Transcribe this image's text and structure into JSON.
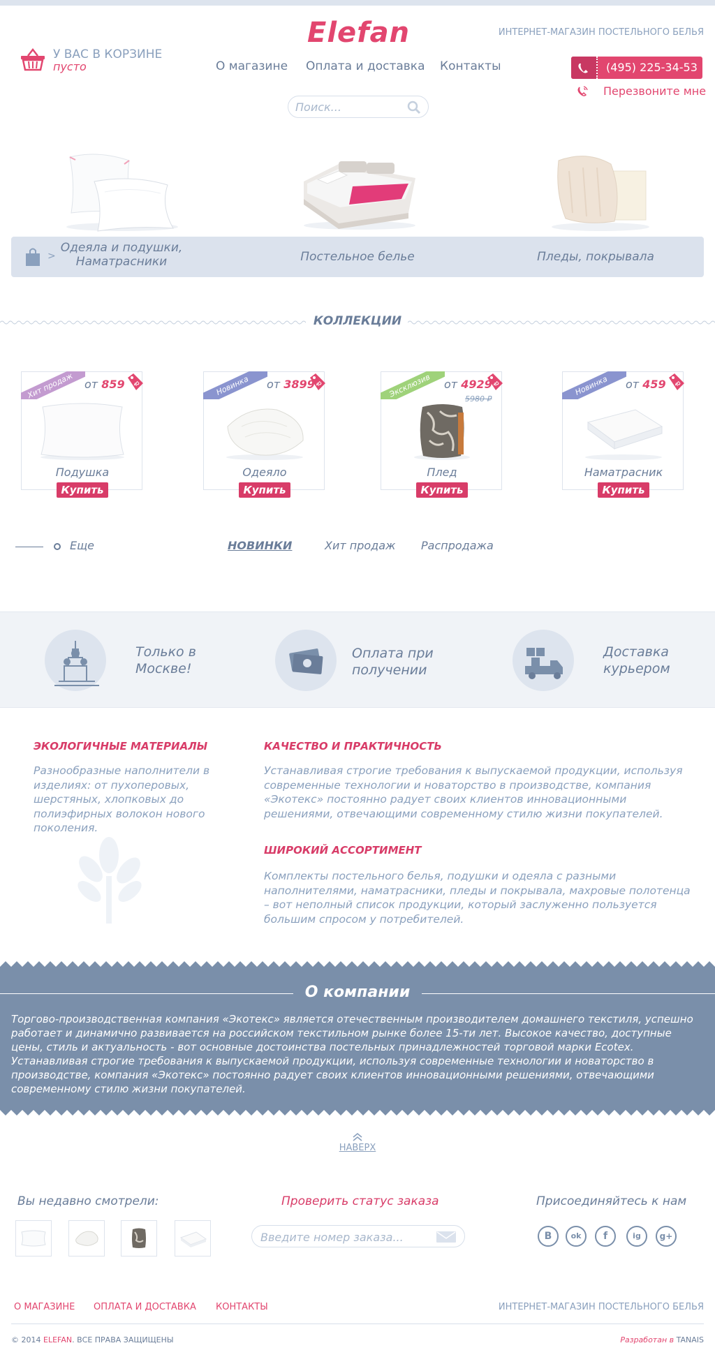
{
  "header": {
    "logo": "Elefan",
    "tagline": "ИНТЕРНЕТ-МАГАЗИН ПОСТЕЛЬНОГО БЕЛЬЯ",
    "cart_label": "У ВАС В КОРЗИНЕ",
    "cart_status": "пусто",
    "nav": [
      "О магазине",
      "Оплата и доставка",
      "Контакты"
    ],
    "phone": "(495) 225-34-53",
    "callback": "Перезвоните мне",
    "search_placeholder": "Поиск..."
  },
  "categories": [
    {
      "label_line1": "Одеяла и подушки,",
      "label_line2": "Наматрасники"
    },
    {
      "label": "Постельное белье"
    },
    {
      "label": "Пледы, покрывала"
    }
  ],
  "collections": {
    "title": "КОЛЛЕКЦИИ",
    "products": [
      {
        "badge": "Хит продаж",
        "prefix": "от",
        "price": "859",
        "name": "Подушка",
        "buy": "Купить",
        "badge_color": "#c39bd0"
      },
      {
        "badge": "Новинка",
        "prefix": "от",
        "price": "3899",
        "name": "Одеяло",
        "buy": "Купить",
        "badge_color": "#8a94cf"
      },
      {
        "badge": "Эксклюзив",
        "prefix": "от",
        "price": "4929",
        "old_price": "5980 ₽",
        "name": "Плед",
        "buy": "Купить",
        "badge_color": "#9fd27a"
      },
      {
        "badge": "Новинка",
        "prefix": "от",
        "price": "459",
        "name": "Наматрасник",
        "buy": "Купить",
        "badge_color": "#8a94cf"
      }
    ],
    "tag_text": "₽",
    "more": "Еще",
    "filters": [
      "НОВИНКИ",
      "Хит продаж",
      "Распродажа"
    ]
  },
  "features": [
    {
      "line1": "Только в",
      "line2": "Москве!"
    },
    {
      "line1": "Оплата при",
      "line2": "получении"
    },
    {
      "line1": "Доставка",
      "line2": "курьером"
    }
  ],
  "info": {
    "eco_title": "ЭКОЛОГИЧНЫЕ МАТЕРИАЛЫ",
    "eco_text": "Разнообразные наполнители в изделиях: от пухоперовых, шерстяных, хлопковых до полиэфирных волокон нового поколения.",
    "quality_title": "КАЧЕСТВО И ПРАКТИЧНОСТЬ",
    "quality_text": "Устанавливая строгие требования к выпускаемой продукции, используя современные технологии и новаторство в производстве, компания «Экотекс» постоянно радует своих клиентов инновационными решениями, отвечающими современному стилю жизни покупателей.",
    "range_title": "ШИРОКИЙ АССОРТИМЕНТ",
    "range_text": "Комплекты постельного белья, подушки и одеяла с разными наполнителями, наматрасники, пледы и покрывала, махровые полотенца – вот неполный список продукции, который заслуженно пользуется большим спросом у потребителей."
  },
  "about": {
    "title": "О компании",
    "text": "Торгово-производственная компания «Экотекс» является отечественным производителем домашнего текстиля, успешно работает и динамично развивается на российском текстильном рынке более 15-ти лет. Высокое качество, доступные цены, стиль и актуальность - вот основные достоинства постельных принадлежностей торговой марки Ecotex. Устанавливая строгие требования к выпускаемой продукции, используя современные технологии и новаторство в производстве, компания «Экотекс» постоянно радует своих клиентов инновационными решениями, отвечающими современному стилю жизни покупателей."
  },
  "to_top": "НАВЕРХ",
  "footer": {
    "recent_title": "Вы недавно смотрели:",
    "order_title": "Проверить статус заказа",
    "order_placeholder": "Введите номер заказа...",
    "social_title": "Присоединяйтесь к нам",
    "social": [
      "B",
      "ok",
      "f",
      "ig",
      "g+"
    ],
    "nav": [
      "О МАГАЗИНЕ",
      "ОПЛАТА И ДОСТАВКА",
      "КОНТАКТЫ"
    ],
    "tagline": "ИНТЕРНЕТ-МАГАЗИН ПОСТЕЛЬНОГО БЕЛЬЯ",
    "copyright_pre": "© 2014",
    "copyright_brand": "ELEFAN",
    "copyright_post": ". ВСЕ ПРАВА ЗАЩИЩЕНЫ",
    "dev_pre": "Разработан в",
    "dev_brand": "TANAIS"
  }
}
